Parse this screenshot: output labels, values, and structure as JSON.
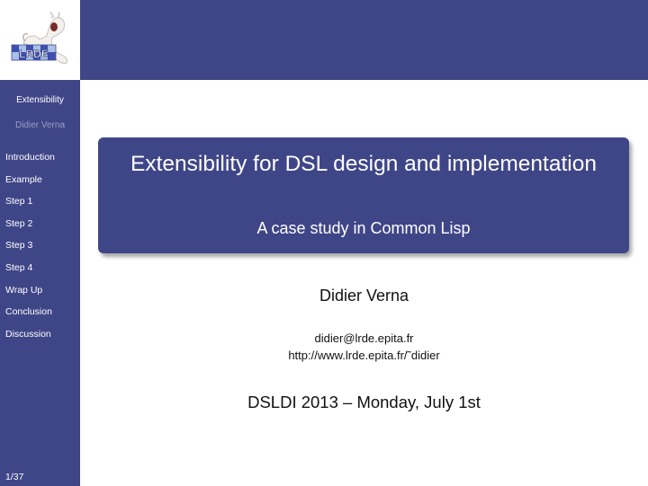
{
  "sidebar": {
    "short_title": "Extensibility",
    "short_author": "Didier Verna",
    "nav_items": [
      {
        "label": "Introduction"
      },
      {
        "label": "Example"
      },
      {
        "label": "Step 1"
      },
      {
        "label": "Step 2"
      },
      {
        "label": "Step 3"
      },
      {
        "label": "Step 4"
      },
      {
        "label": "Wrap Up"
      },
      {
        "label": "Conclusion"
      },
      {
        "label": "Discussion"
      }
    ],
    "page_number": "1/37",
    "logo": {
      "text": "LRDE",
      "icon": "lrde-logo-icon"
    }
  },
  "title_block": {
    "title": "Extensibility for DSL design and implementation",
    "subtitle": "A case study in Common Lisp"
  },
  "author": {
    "name": "Didier Verna",
    "email": "didier@lrde.epita.fr",
    "url": "http://www.lrde.epita.fr/˜didier"
  },
  "event": "DSLDI 2013 – Monday, July 1st",
  "colors": {
    "theme": "#3f4687",
    "sidebar_dim_text": "#9a9ec7"
  }
}
